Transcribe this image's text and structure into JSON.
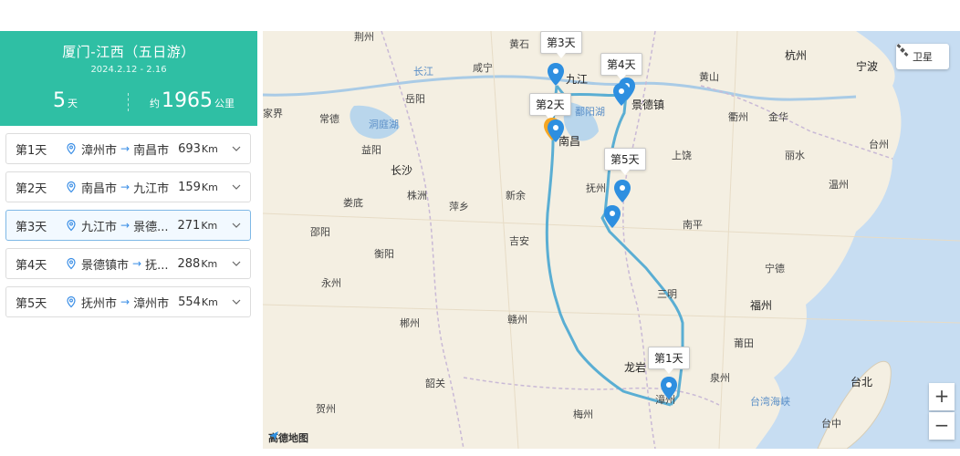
{
  "trip": {
    "title": "厦门-江西（五日游）",
    "date_range": "2024.2.12 - 2.16",
    "days_num": "5",
    "days_unit": "天",
    "distance_prefix": "约",
    "distance_num": "1965",
    "distance_unit": "公里"
  },
  "days": [
    {
      "label": "第1天",
      "from": "漳州市",
      "to": "南昌市",
      "dist": "693",
      "unit": "Km"
    },
    {
      "label": "第2天",
      "from": "南昌市",
      "to": "九江市",
      "dist": "159",
      "unit": "Km"
    },
    {
      "label": "第3天",
      "from": "九江市",
      "to": "景德...",
      "dist": "271",
      "unit": "Km"
    },
    {
      "label": "第4天",
      "from": "景德镇市",
      "to": "抚...",
      "dist": "288",
      "unit": "Km"
    },
    {
      "label": "第5天",
      "from": "抚州市",
      "to": "漳州市",
      "dist": "554",
      "unit": "Km"
    }
  ],
  "active_day_index": 2,
  "map": {
    "callouts": [
      "第3天",
      "第4天",
      "第2天",
      "第5天",
      "第1天"
    ],
    "satellite_label": "卫星",
    "zoom_in": "+",
    "zoom_out": "−",
    "logo": "高德地图",
    "labels": {
      "jingzhou": "荆州",
      "huangshi": "黄石",
      "xianning": "咸宁",
      "changjiang": "长江",
      "yueyang": "岳阳",
      "jiujiang": "九江",
      "huangshan": "黄山",
      "hangzhou": "杭州",
      "ningbo": "宁波",
      "jiangjie": "家界",
      "changde": "常德",
      "dongtinghu": "洞庭湖",
      "poyanghu": "鄱阳湖",
      "jingdezhen": "景德镇",
      "quzhou": "衢州",
      "jinhua": "金华",
      "taizhou": "台州",
      "yiyang": "益阳",
      "nanchang": "南昌",
      "changsha": "长沙",
      "shangrao": "上饶",
      "lishui": "丽水",
      "wenzhou": "温州",
      "loudi": "娄底",
      "zhuzhou": "株洲",
      "pingxiang": "萍乡",
      "xinyu": "新余",
      "fuzhou_jx": "抚州",
      "nanping": "南平",
      "shaoyang": "邵阳",
      "hengyang": "衡阳",
      "jian": "吉安",
      "ningde": "宁德",
      "yongzhou": "永州",
      "sanming": "三明",
      "fuzhou": "福州",
      "chenzhou": "郴州",
      "ganzhou": "赣州",
      "putian": "莆田",
      "longyan": "龙岩",
      "quanzhou": "泉州",
      "shaoguan": "韶关",
      "taipei": "台北",
      "taiwanstrait": "台湾海峡",
      "zhangzhou": "漳州",
      "hezhou": "贺州",
      "meizhou": "梅州",
      "taichung": "台中"
    }
  },
  "colors": {
    "header_bg": "#2fbfa4",
    "route": "#5aaed3",
    "marker": "#2e8fe0",
    "sea": "#c7ddf2",
    "active_border": "#7fb8e6"
  }
}
